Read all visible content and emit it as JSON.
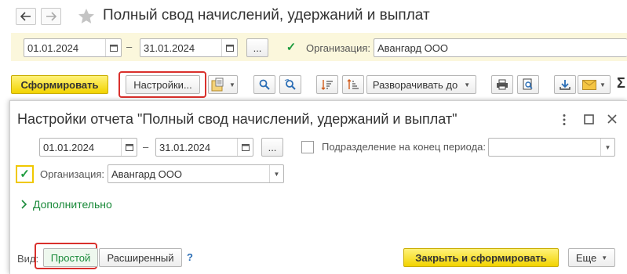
{
  "window": {
    "title": "Полный свод начислений, удержаний и выплат",
    "back_icon": "arrow-left-icon",
    "forward_icon": "arrow-right-icon",
    "favorite_icon": "star-icon"
  },
  "filters": {
    "date_from": "01.01.2024",
    "date_separator": "–",
    "date_to": "31.01.2024",
    "period_button": "...",
    "organization_checked": true,
    "organization_label": "Организация:",
    "organization_value": "Авангард ООО"
  },
  "toolbar": {
    "generate_label": "Сформировать",
    "settings_label": "Настройки...",
    "expand_label": "Разворачивать до",
    "sum_label": "Σ"
  },
  "dialog": {
    "title": "Настройки отчета \"Полный свод начислений, удержаний и выплат\"",
    "more_icon": "more-vertical-icon",
    "maximize_icon": "maximize-icon",
    "close_icon": "close-icon",
    "date_from": "01.01.2024",
    "date_separator": "–",
    "date_to": "31.01.2024",
    "period_button": "...",
    "subdivision_checked": false,
    "subdivision_label": "Подразделение на конец периода:",
    "subdivision_value": "",
    "organization_checked": true,
    "organization_label": "Организация:",
    "organization_value": "Авангард ООО",
    "advanced_toggle": "Дополнительно",
    "view_label": "Вид:",
    "view_simple": "Простой",
    "view_extended": "Расширенный",
    "help_label": "?",
    "close_and_generate": "Закрыть и сформировать",
    "more_label": "Еще"
  },
  "colors": {
    "accent_yellow": "#f2d300",
    "strip_yellow": "#fbf7dc",
    "highlight_red": "#d9302c",
    "green": "#1a8a3a"
  }
}
